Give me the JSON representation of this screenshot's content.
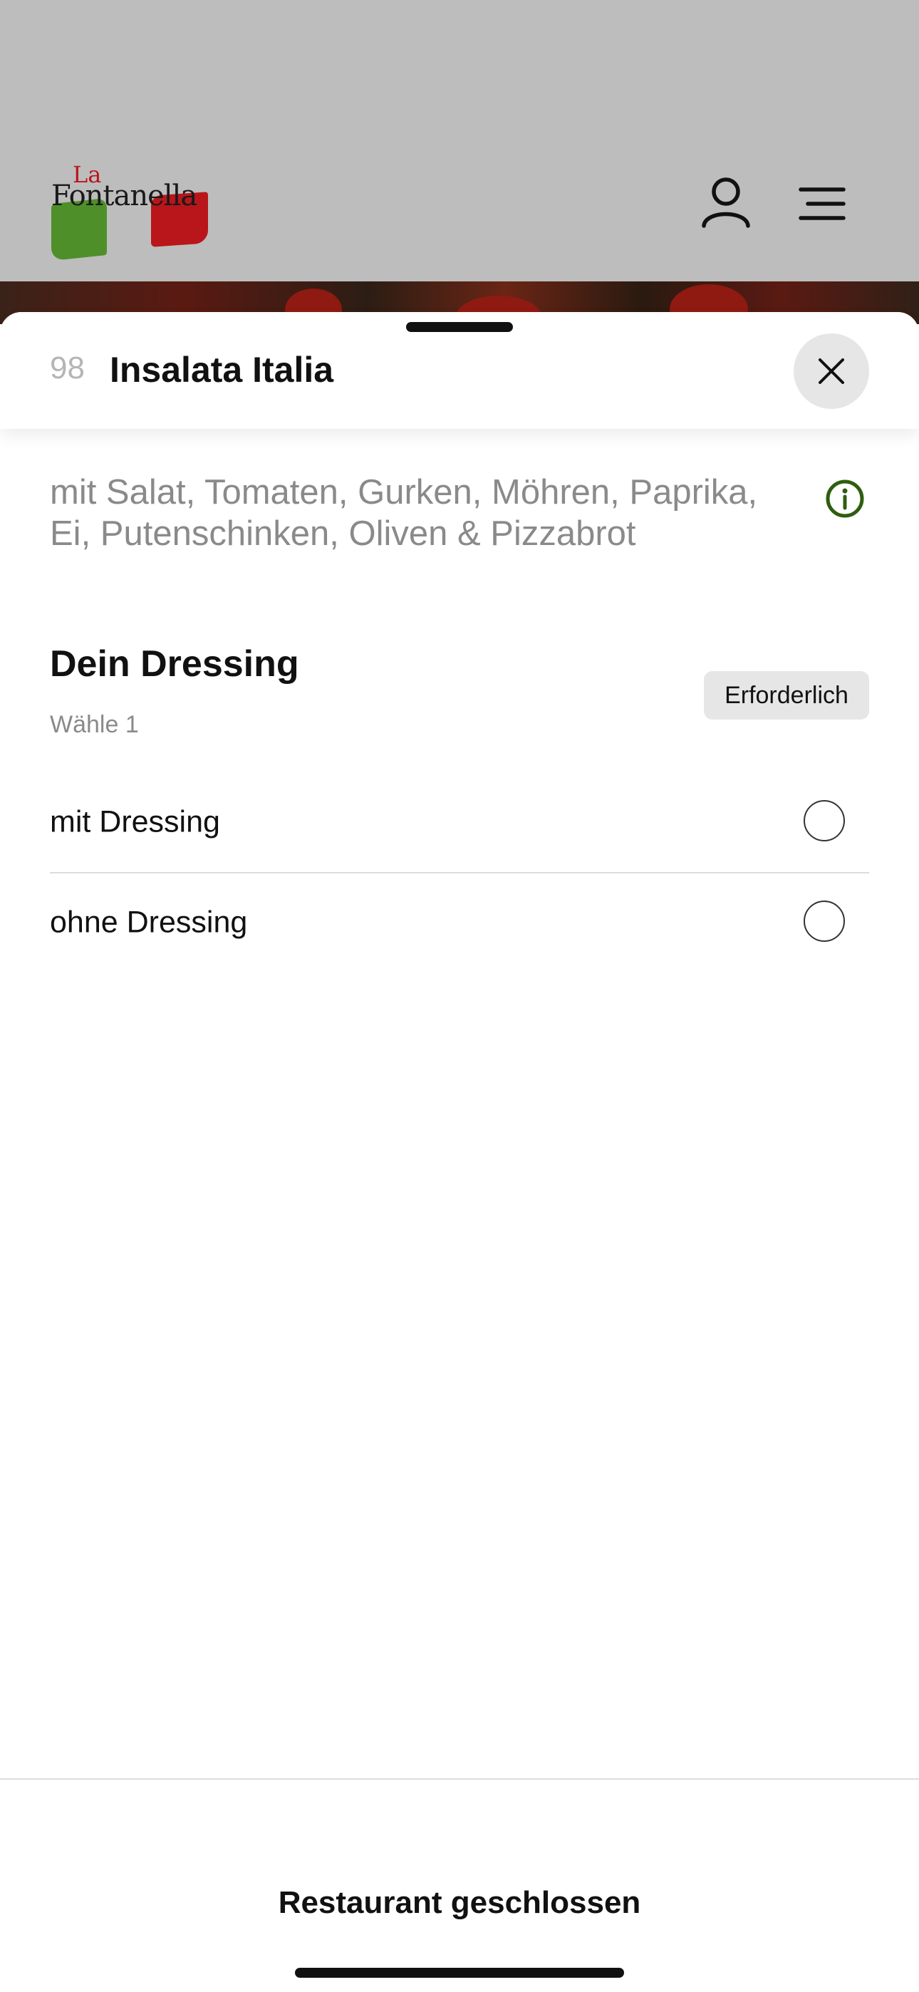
{
  "header": {
    "logo_small": "La",
    "logo_name": "Fontanella",
    "user_icon": "user-icon",
    "menu_icon": "menu-icon"
  },
  "item": {
    "number": "98",
    "title": "Insalata Italia",
    "description": "mit Salat, Tomaten, Gurken, Möhren, Paprika, Ei, Putenschinken, Oliven & Pizzabrot",
    "info_icon": "info-icon",
    "close_icon": "close-icon"
  },
  "option_group": {
    "title": "Dein Dressing",
    "subtitle": "Wähle 1",
    "badge": "Erforderlich",
    "options": [
      {
        "label": "mit Dressing",
        "selected": false
      },
      {
        "label": "ohne Dressing",
        "selected": false
      }
    ]
  },
  "footer": {
    "status": "Restaurant geschlossen"
  },
  "colors": {
    "info_icon": "#2e5e0e",
    "logo_green": "#4f8f2a",
    "logo_red": "#b8161a",
    "backdrop": "#bdbdbd"
  }
}
